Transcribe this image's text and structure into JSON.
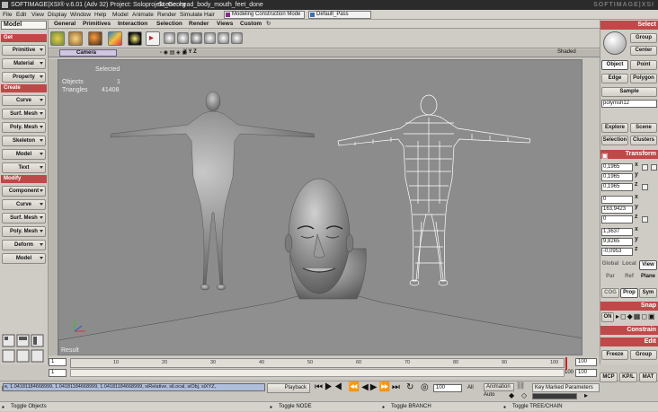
{
  "titlebar": {
    "text": "SOFTIMAGE|XSI® v.6.01 (Adv 32) Project: Soloprojekt_Georg",
    "scene": "Scene: head_body_mouth_feet_done",
    "brand": "SOFTIMAGE|XSI"
  },
  "menu": [
    "File",
    "Edit",
    "View",
    "Display",
    "Window",
    "Help",
    "Model",
    "Animate",
    "Render",
    "Simulate",
    "Hair"
  ],
  "layout_combo": "Modeling Construction Mode",
  "pass_combo": "Default_Pass",
  "tabs": [
    "General",
    "Primitives",
    "Interaction",
    "Selection",
    "Render",
    "Views",
    "Custom"
  ],
  "left": {
    "mode": "Model",
    "get": "Get",
    "get_items": [
      "Primitive",
      "Material",
      "Property"
    ],
    "create": "Create",
    "create_items": [
      "Curve",
      "Surf. Mesh",
      "Poly. Mesh",
      "Skeleton",
      "Model",
      "Text"
    ],
    "modify": "Modify",
    "modify_items": [
      "Component",
      "Curve",
      "Surf. Mesh",
      "Poly. Mesh",
      "Deform",
      "Model"
    ]
  },
  "viewport": {
    "camera": "Camera",
    "wireframe_mode": "Shaded",
    "xyz": "X Y Z",
    "selected_label": "Selected",
    "objects_label": "Objects",
    "objects_value": "1",
    "triangles_label": "Triangles",
    "triangles_value": "41408",
    "result": "Result"
  },
  "right": {
    "select": "Select",
    "group": "Group",
    "center": "Center",
    "object": "Object",
    "point": "Point",
    "edge": "Edge",
    "polygon": "Polygon",
    "sample": "Sample",
    "selname": "polymsh12",
    "explore": "Explore",
    "scene": "Scene",
    "selection": "Selection",
    "clusters": "Clusters",
    "transform": "Transform",
    "scl": [
      {
        "v": "0,1965",
        "a": "x"
      },
      {
        "v": "0,1965",
        "a": "y"
      },
      {
        "v": "0,1965",
        "a": "z"
      }
    ],
    "rot": [
      {
        "v": "0",
        "a": "x"
      },
      {
        "v": "163,9423",
        "a": "y"
      },
      {
        "v": "0",
        "a": "z"
      }
    ],
    "pos": [
      {
        "v": "1,3637",
        "a": "x"
      },
      {
        "v": "9,8265",
        "a": "y"
      },
      {
        "v": "-0,0953",
        "a": "z"
      }
    ],
    "global": "Global",
    "local": "Local",
    "view": "View",
    "par": "Par",
    "ref": "Ref",
    "plane": "Plane",
    "cog": "COG",
    "prop": "Prop",
    "sym": "Sym",
    "snap": "Snap",
    "on": "ON",
    "constrain": "Constrain",
    "edit": "Edit",
    "freeze": "Freeze",
    "group2": "Group",
    "mcp": "MCP",
    "kpl": "KP/L",
    "mat": "MAT"
  },
  "timeline": {
    "start": "1",
    "end": "100",
    "end2": "100",
    "current": "100",
    "ticks": [
      "10",
      "20",
      "30",
      "40",
      "50",
      "60",
      "70",
      "80",
      "90",
      "100"
    ]
  },
  "bottom": {
    "cmdline": "e, 1.04181184668999, 1.04181184668999, 1.04181184668999, siRelative, siLocal, siObj, siXYZ,",
    "playback": "Playback",
    "frame": "100",
    "all": "All",
    "animation": "Animation",
    "auto": "Auto",
    "keymarked": "Key Marked Parameters"
  },
  "status": {
    "left": "Toggle Objects",
    "mid1": "Toggle NODE",
    "mid2": "Toggle BRANCH",
    "mid3": "Toggle TREE/CHAIN"
  },
  "colors": {
    "header_red": "#c04848",
    "viewport_bg": "#8c8c8c"
  }
}
